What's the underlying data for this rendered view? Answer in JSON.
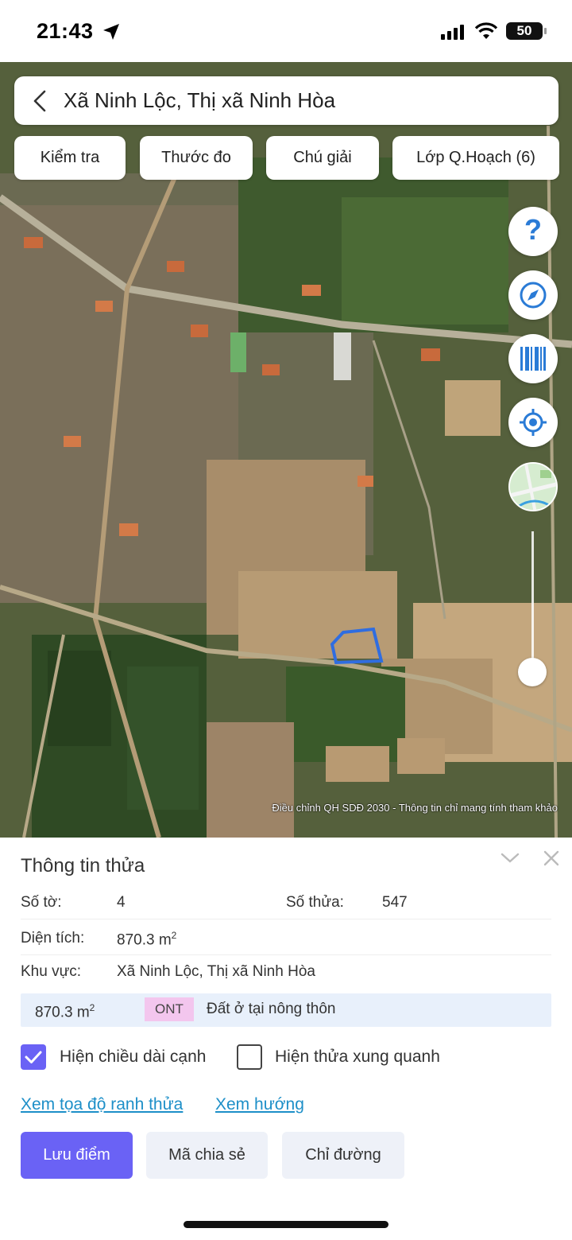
{
  "status_bar": {
    "time": "21:43",
    "battery": "50",
    "icons": [
      "location-arrow-icon",
      "cellular-signal-icon",
      "wifi-icon",
      "battery-icon"
    ]
  },
  "map": {
    "search_title": "Xã Ninh Lộc, Thị xã Ninh Hòa",
    "tabs": [
      {
        "label": "Kiểm tra"
      },
      {
        "label": "Thước đo"
      },
      {
        "label": "Chú giải"
      },
      {
        "label": "Lớp Q.Hoạch (6)"
      }
    ],
    "help_glyph": "?",
    "right_controls": [
      "help-icon",
      "compass-icon",
      "barcode-icon",
      "locate-icon",
      "basemap-thumbnail",
      "zoom-slider"
    ],
    "disclaimer": "Điều chỉnh QH SDĐ 2030 - Thông tin chỉ mang tính tham khảo",
    "parcel_outline_color": "#2f6de0"
  },
  "panel": {
    "title": "Thông tin thửa",
    "so_to_label": "Số tờ:",
    "so_to_value": "4",
    "so_thua_label": "Số thửa:",
    "so_thua_value": "547",
    "dien_tich_label": "Diện tích:",
    "dien_tich_value": "870.3 m",
    "dien_tich_unit_sup": "2",
    "khu_vuc_label": "Khu vực:",
    "khu_vuc_value": "Xã Ninh Lộc, Thị xã Ninh Hòa",
    "land_use": {
      "area": "870.3 m",
      "area_sup": "2",
      "code": "ONT",
      "code_color": "#f3c6ee",
      "description": "Đất ở tại nông thôn"
    },
    "checkbox_edge_length": {
      "label": "Hiện chiều dài cạnh",
      "checked": true
    },
    "checkbox_neighbors": {
      "label": "Hiện thửa xung quanh",
      "checked": false
    },
    "link_coordinates": "Xem tọa độ ranh thửa",
    "link_direction": "Xem hướng",
    "btn_save": "Lưu điểm",
    "btn_share": "Mã chia sẻ",
    "btn_route": "Chỉ đường",
    "accent_color": "#6a62f5",
    "link_color": "#1d8fc8"
  }
}
